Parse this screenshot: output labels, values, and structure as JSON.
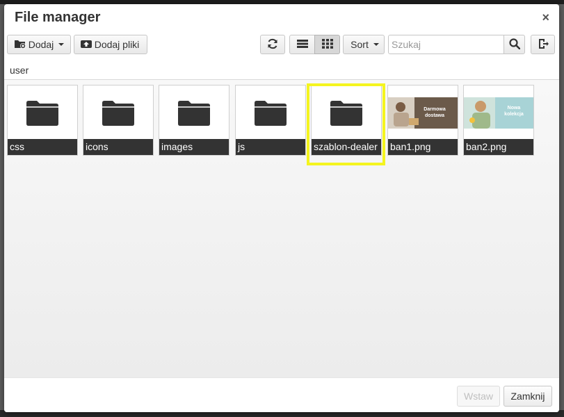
{
  "dialog": {
    "title": "File manager",
    "close_symbol": "×"
  },
  "toolbar": {
    "add_label": "Dodaj",
    "upload_label": "Dodaj pliki",
    "sort_label": "Sort",
    "search_placeholder": "Szukaj",
    "icons": {
      "add": "folder-add-icon",
      "upload": "upload-icon",
      "refresh": "refresh-icon",
      "list_view": "list-view-icon",
      "grid_view": "grid-view-icon",
      "search": "search-icon",
      "exit": "exit-icon"
    }
  },
  "breadcrumb": {
    "path": "user"
  },
  "files": [
    {
      "name": "css",
      "type": "folder"
    },
    {
      "name": "icons",
      "type": "folder"
    },
    {
      "name": "images",
      "type": "folder"
    },
    {
      "name": "js",
      "type": "folder"
    },
    {
      "name": "szablon-dealer",
      "type": "folder",
      "highlighted": true
    },
    {
      "name": "ban1.png",
      "type": "image",
      "caption_line1": "Darmowa",
      "caption_line2": "dostawa"
    },
    {
      "name": "ban2.png",
      "type": "image",
      "caption_line1": "Nowa",
      "caption_line2": "kolekcja"
    }
  ],
  "footer": {
    "insert_label": "Wstaw",
    "close_label": "Zamknij"
  },
  "colors": {
    "highlight": "#f4f41f",
    "tile_label_bg": "#333333",
    "folder_icon": "#333333"
  }
}
